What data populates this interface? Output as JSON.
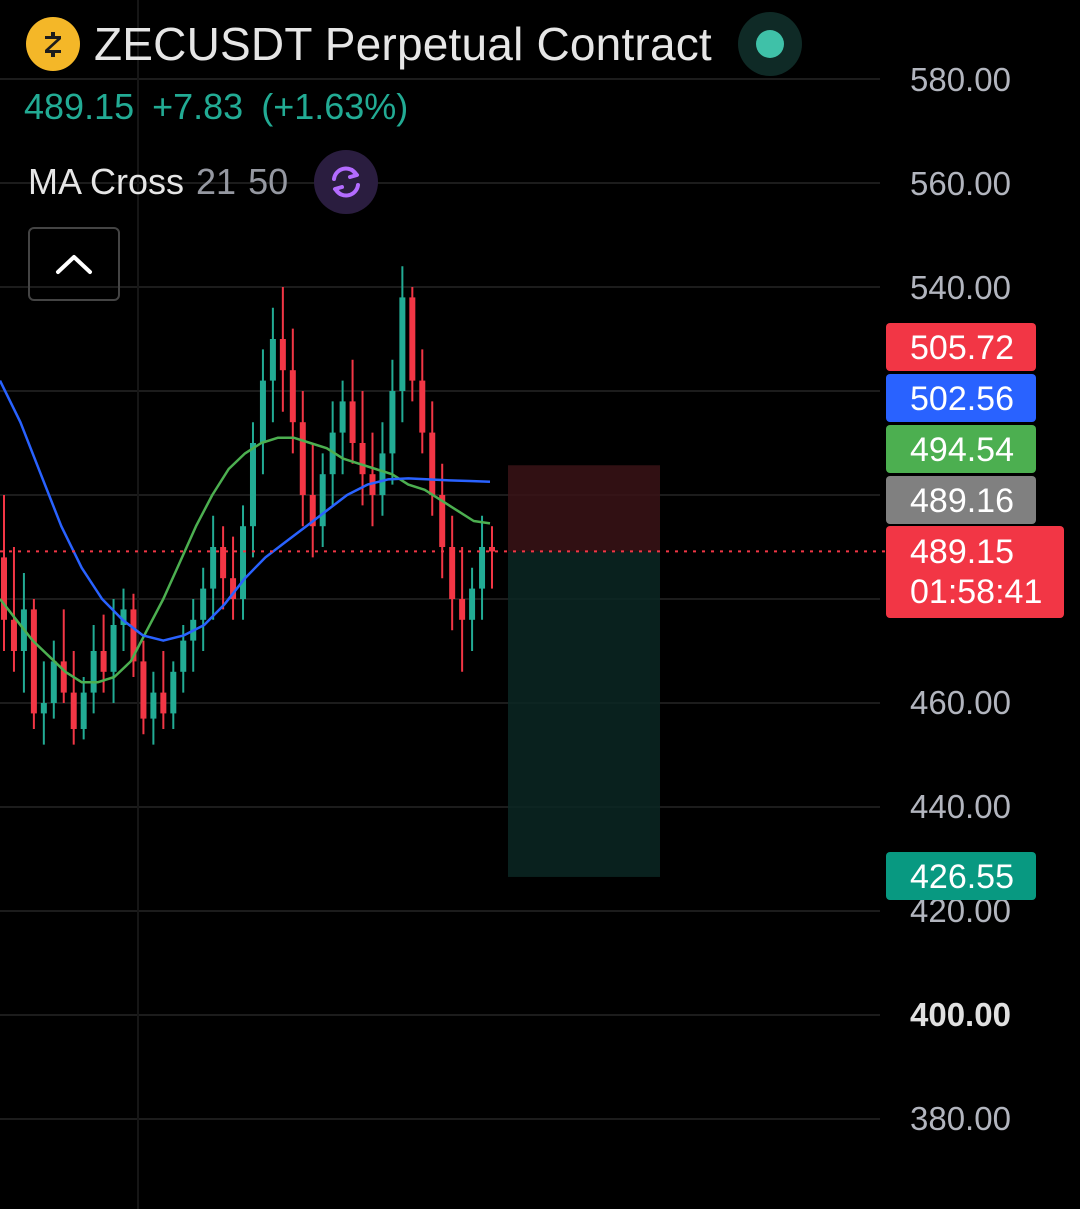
{
  "header": {
    "title": "ZECUSDT Perpetual Contract",
    "coin_icon": "zcash-coin-icon",
    "status_icon": "live-status-dot"
  },
  "quote": {
    "last": "489.15",
    "change": "+7.83",
    "change_pct": "(+1.63%)"
  },
  "indicator": {
    "name": "MA Cross",
    "fast": "21",
    "slow": "50",
    "settings_icon": "refresh-icon"
  },
  "collapse_icon": "chevron-up-icon",
  "price_axis": {
    "labels": [
      "580.00",
      "560.00",
      "540.00",
      "460.00",
      "440.00",
      "420.00",
      "400.00",
      "380.00"
    ],
    "bold_label": "400.00"
  },
  "tags": {
    "stop": "505.72",
    "ma_slow": "502.56",
    "ma_fast": "494.54",
    "mark": "489.16",
    "current_price": "489.15",
    "countdown": "01:58:41",
    "target": "426.55"
  },
  "colors": {
    "up": "#22ab94",
    "down": "#f23645",
    "ma_fast": "#4caf50",
    "ma_slow": "#2962ff",
    "grid": "#1c1c1c"
  },
  "chart_data": {
    "type": "candlestick",
    "ylim": [
      370,
      590
    ],
    "candles_ohlc": [
      [
        488,
        500,
        470,
        476
      ],
      [
        476,
        490,
        466,
        470
      ],
      [
        470,
        485,
        462,
        478
      ],
      [
        478,
        480,
        455,
        458
      ],
      [
        458,
        468,
        452,
        460
      ],
      [
        460,
        472,
        457,
        468
      ],
      [
        468,
        478,
        460,
        462
      ],
      [
        462,
        470,
        452,
        455
      ],
      [
        455,
        465,
        453,
        462
      ],
      [
        462,
        475,
        458,
        470
      ],
      [
        470,
        477,
        462,
        466
      ],
      [
        466,
        480,
        460,
        475
      ],
      [
        475,
        482,
        470,
        478
      ],
      [
        478,
        481,
        465,
        468
      ],
      [
        468,
        472,
        454,
        457
      ],
      [
        457,
        466,
        452,
        462
      ],
      [
        462,
        470,
        455,
        458
      ],
      [
        458,
        468,
        455,
        466
      ],
      [
        466,
        475,
        462,
        472
      ],
      [
        472,
        480,
        466,
        476
      ],
      [
        476,
        486,
        470,
        482
      ],
      [
        482,
        496,
        476,
        490
      ],
      [
        490,
        494,
        478,
        484
      ],
      [
        484,
        492,
        476,
        480
      ],
      [
        480,
        498,
        476,
        494
      ],
      [
        494,
        514,
        488,
        510
      ],
      [
        510,
        528,
        504,
        522
      ],
      [
        522,
        536,
        514,
        530
      ],
      [
        530,
        540,
        516,
        524
      ],
      [
        524,
        532,
        508,
        514
      ],
      [
        514,
        520,
        494,
        500
      ],
      [
        500,
        510,
        488,
        494
      ],
      [
        494,
        508,
        490,
        504
      ],
      [
        504,
        518,
        498,
        512
      ],
      [
        512,
        522,
        504,
        518
      ],
      [
        518,
        526,
        506,
        510
      ],
      [
        510,
        520,
        498,
        504
      ],
      [
        504,
        512,
        494,
        500
      ],
      [
        500,
        514,
        496,
        508
      ],
      [
        508,
        526,
        502,
        520
      ],
      [
        520,
        544,
        514,
        538
      ],
      [
        538,
        540,
        518,
        522
      ],
      [
        522,
        528,
        508,
        512
      ],
      [
        512,
        518,
        496,
        500
      ],
      [
        500,
        506,
        484,
        490
      ],
      [
        490,
        496,
        474,
        480
      ],
      [
        480,
        490,
        466,
        476
      ],
      [
        476,
        486,
        470,
        482
      ],
      [
        482,
        496,
        476,
        490
      ],
      [
        490,
        494,
        482,
        489.15
      ]
    ],
    "ma21": [
      480,
      476,
      472,
      469,
      466,
      464,
      464,
      465,
      468,
      474,
      480,
      487,
      494,
      500,
      505,
      508,
      510,
      511,
      511,
      510,
      509,
      507,
      506,
      505,
      504,
      502,
      501,
      499,
      497,
      495,
      494.54
    ],
    "ma50": [
      522,
      514,
      504,
      494,
      486,
      480,
      476,
      473,
      472,
      473,
      475,
      479,
      484,
      488,
      491,
      494,
      497,
      500,
      502,
      503,
      503.2,
      503,
      502.8,
      502.7,
      502.56
    ]
  }
}
